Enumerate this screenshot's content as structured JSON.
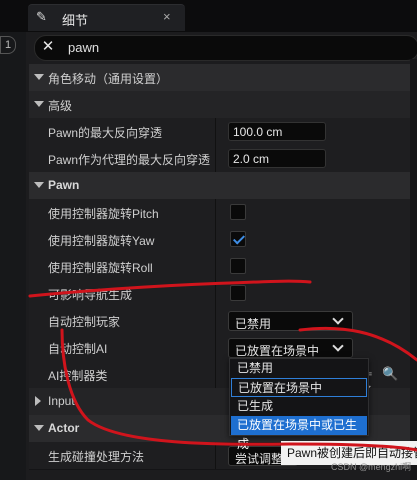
{
  "tab": {
    "title": "细节",
    "close": "×"
  },
  "left_badge": "1",
  "search": {
    "value": "pawn"
  },
  "sections": {
    "movement": "角色移动（通用设置）",
    "advanced": "高级",
    "pawn": "Pawn",
    "input": "Input",
    "actor": "Actor"
  },
  "props": {
    "max_reverse": {
      "label": "Pawn的最大反向穿透",
      "value": "100.0 cm"
    },
    "max_reverse_proxy": {
      "label": "Pawn作为代理的最大反向穿透",
      "value": "2.0 cm"
    },
    "rot_pitch": {
      "label": "使用控制器旋转Pitch",
      "checked": false
    },
    "rot_yaw": {
      "label": "使用控制器旋转Yaw",
      "checked": true
    },
    "rot_roll": {
      "label": "使用控制器旋转Roll",
      "checked": false
    },
    "affect_nav": {
      "label": "可影响导航生成",
      "checked": false
    },
    "auto_player": {
      "label": "自动控制玩家",
      "value": "已禁用"
    },
    "auto_ai": {
      "label": "自动控制AI",
      "value": "已放置在场景中"
    },
    "ai_class": {
      "label": "AI控制器类"
    },
    "collision": {
      "label": "生成碰撞处理方法",
      "value": "尝试调整"
    }
  },
  "dropdown": {
    "options": [
      "已禁用",
      "已放置在场景中",
      "已生成",
      "已放置在场景中或已生成"
    ],
    "hovered_index": 1,
    "selected_index": 3
  },
  "tooltip": "Pawn被创建后即自动接管",
  "watermark": "CSDN @mengzhi啊",
  "colors": {
    "accent": "#1e6fd0",
    "annotation": "#d0141c"
  }
}
